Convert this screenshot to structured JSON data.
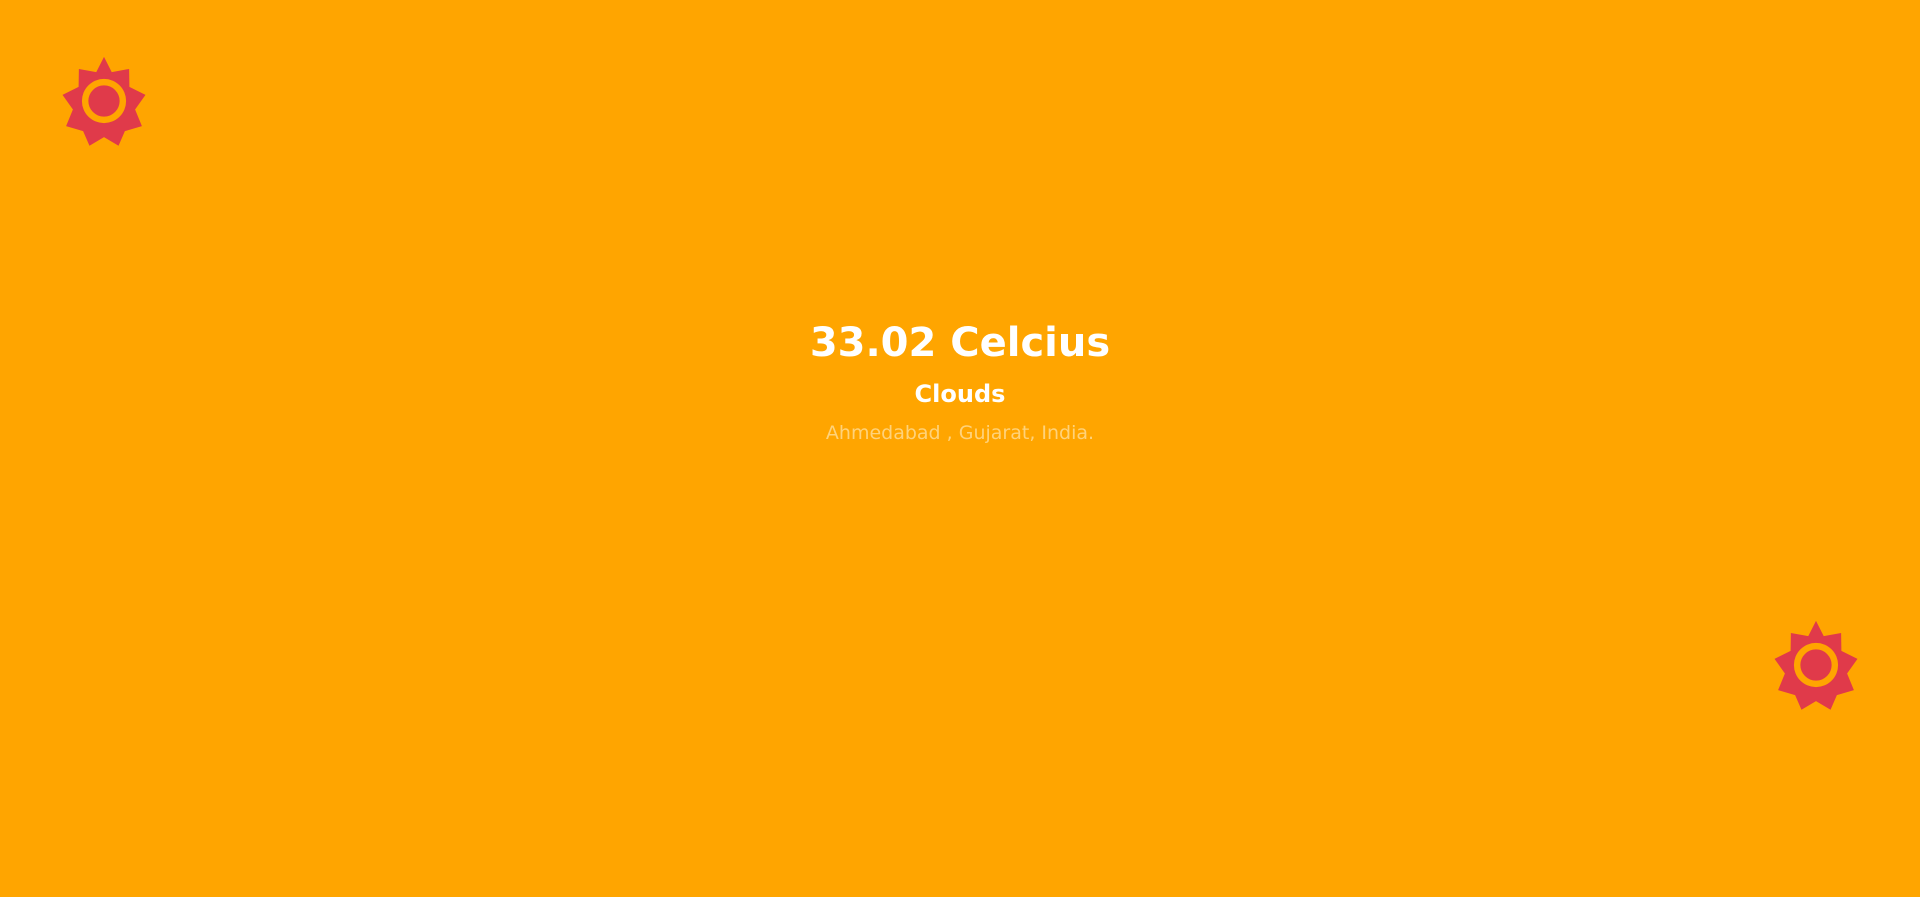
{
  "weather": {
    "temperature": "33.02 Celcius",
    "condition": "Clouds",
    "location": "Ahmedabad , Gujarat, India."
  },
  "icons": {
    "primary": "sun-icon",
    "secondary": "sun-icon"
  },
  "colors": {
    "background": "#FFA500",
    "sun": "#E03A4A",
    "heading_text": "#FFFFFF",
    "location_text": "#FFD27A"
  }
}
